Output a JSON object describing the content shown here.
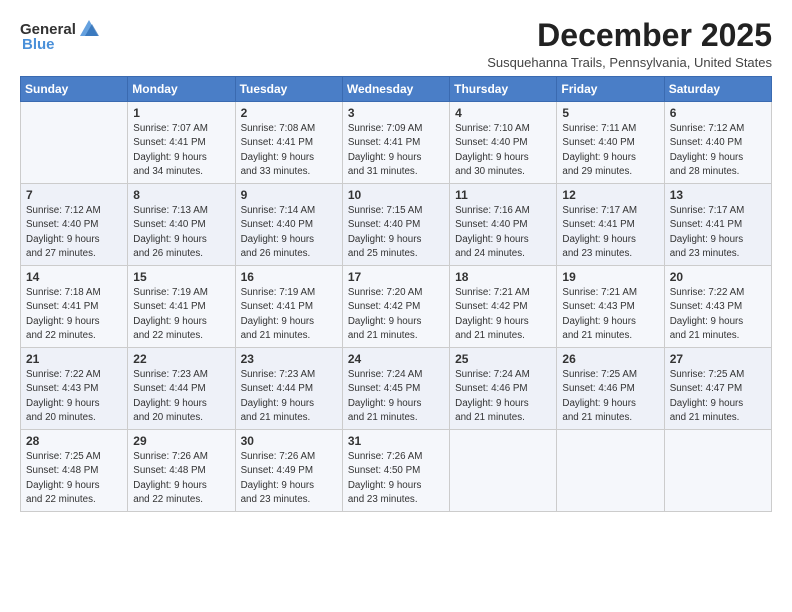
{
  "logo": {
    "general": "General",
    "blue": "Blue"
  },
  "header": {
    "month": "December 2025",
    "location": "Susquehanna Trails, Pennsylvania, United States"
  },
  "weekdays": [
    "Sunday",
    "Monday",
    "Tuesday",
    "Wednesday",
    "Thursday",
    "Friday",
    "Saturday"
  ],
  "weeks": [
    [
      {
        "day": "",
        "detail": ""
      },
      {
        "day": "1",
        "detail": "Sunrise: 7:07 AM\nSunset: 4:41 PM\nDaylight: 9 hours\nand 34 minutes."
      },
      {
        "day": "2",
        "detail": "Sunrise: 7:08 AM\nSunset: 4:41 PM\nDaylight: 9 hours\nand 33 minutes."
      },
      {
        "day": "3",
        "detail": "Sunrise: 7:09 AM\nSunset: 4:41 PM\nDaylight: 9 hours\nand 31 minutes."
      },
      {
        "day": "4",
        "detail": "Sunrise: 7:10 AM\nSunset: 4:40 PM\nDaylight: 9 hours\nand 30 minutes."
      },
      {
        "day": "5",
        "detail": "Sunrise: 7:11 AM\nSunset: 4:40 PM\nDaylight: 9 hours\nand 29 minutes."
      },
      {
        "day": "6",
        "detail": "Sunrise: 7:12 AM\nSunset: 4:40 PM\nDaylight: 9 hours\nand 28 minutes."
      }
    ],
    [
      {
        "day": "7",
        "detail": "Sunrise: 7:12 AM\nSunset: 4:40 PM\nDaylight: 9 hours\nand 27 minutes."
      },
      {
        "day": "8",
        "detail": "Sunrise: 7:13 AM\nSunset: 4:40 PM\nDaylight: 9 hours\nand 26 minutes."
      },
      {
        "day": "9",
        "detail": "Sunrise: 7:14 AM\nSunset: 4:40 PM\nDaylight: 9 hours\nand 26 minutes."
      },
      {
        "day": "10",
        "detail": "Sunrise: 7:15 AM\nSunset: 4:40 PM\nDaylight: 9 hours\nand 25 minutes."
      },
      {
        "day": "11",
        "detail": "Sunrise: 7:16 AM\nSunset: 4:40 PM\nDaylight: 9 hours\nand 24 minutes."
      },
      {
        "day": "12",
        "detail": "Sunrise: 7:17 AM\nSunset: 4:41 PM\nDaylight: 9 hours\nand 23 minutes."
      },
      {
        "day": "13",
        "detail": "Sunrise: 7:17 AM\nSunset: 4:41 PM\nDaylight: 9 hours\nand 23 minutes."
      }
    ],
    [
      {
        "day": "14",
        "detail": "Sunrise: 7:18 AM\nSunset: 4:41 PM\nDaylight: 9 hours\nand 22 minutes."
      },
      {
        "day": "15",
        "detail": "Sunrise: 7:19 AM\nSunset: 4:41 PM\nDaylight: 9 hours\nand 22 minutes."
      },
      {
        "day": "16",
        "detail": "Sunrise: 7:19 AM\nSunset: 4:41 PM\nDaylight: 9 hours\nand 21 minutes."
      },
      {
        "day": "17",
        "detail": "Sunrise: 7:20 AM\nSunset: 4:42 PM\nDaylight: 9 hours\nand 21 minutes."
      },
      {
        "day": "18",
        "detail": "Sunrise: 7:21 AM\nSunset: 4:42 PM\nDaylight: 9 hours\nand 21 minutes."
      },
      {
        "day": "19",
        "detail": "Sunrise: 7:21 AM\nSunset: 4:43 PM\nDaylight: 9 hours\nand 21 minutes."
      },
      {
        "day": "20",
        "detail": "Sunrise: 7:22 AM\nSunset: 4:43 PM\nDaylight: 9 hours\nand 21 minutes."
      }
    ],
    [
      {
        "day": "21",
        "detail": "Sunrise: 7:22 AM\nSunset: 4:43 PM\nDaylight: 9 hours\nand 20 minutes."
      },
      {
        "day": "22",
        "detail": "Sunrise: 7:23 AM\nSunset: 4:44 PM\nDaylight: 9 hours\nand 20 minutes."
      },
      {
        "day": "23",
        "detail": "Sunrise: 7:23 AM\nSunset: 4:44 PM\nDaylight: 9 hours\nand 21 minutes."
      },
      {
        "day": "24",
        "detail": "Sunrise: 7:24 AM\nSunset: 4:45 PM\nDaylight: 9 hours\nand 21 minutes."
      },
      {
        "day": "25",
        "detail": "Sunrise: 7:24 AM\nSunset: 4:46 PM\nDaylight: 9 hours\nand 21 minutes."
      },
      {
        "day": "26",
        "detail": "Sunrise: 7:25 AM\nSunset: 4:46 PM\nDaylight: 9 hours\nand 21 minutes."
      },
      {
        "day": "27",
        "detail": "Sunrise: 7:25 AM\nSunset: 4:47 PM\nDaylight: 9 hours\nand 21 minutes."
      }
    ],
    [
      {
        "day": "28",
        "detail": "Sunrise: 7:25 AM\nSunset: 4:48 PM\nDaylight: 9 hours\nand 22 minutes."
      },
      {
        "day": "29",
        "detail": "Sunrise: 7:26 AM\nSunset: 4:48 PM\nDaylight: 9 hours\nand 22 minutes."
      },
      {
        "day": "30",
        "detail": "Sunrise: 7:26 AM\nSunset: 4:49 PM\nDaylight: 9 hours\nand 23 minutes."
      },
      {
        "day": "31",
        "detail": "Sunrise: 7:26 AM\nSunset: 4:50 PM\nDaylight: 9 hours\nand 23 minutes."
      },
      {
        "day": "",
        "detail": ""
      },
      {
        "day": "",
        "detail": ""
      },
      {
        "day": "",
        "detail": ""
      }
    ]
  ]
}
